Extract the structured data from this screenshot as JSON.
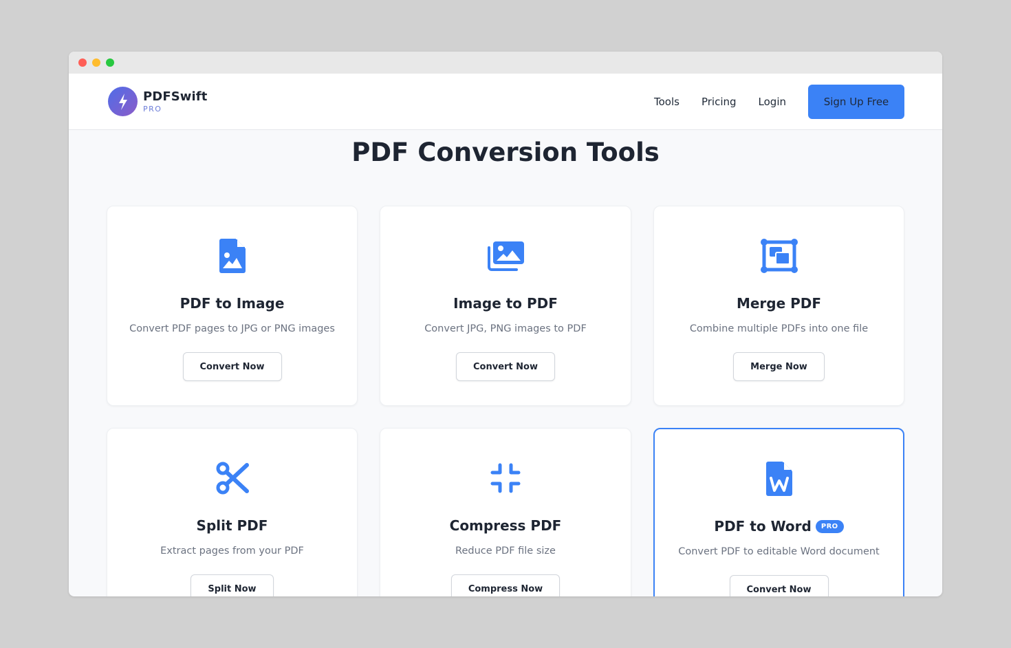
{
  "brand": {
    "name": "PDFSwift",
    "subtitle": "PRO"
  },
  "nav": {
    "links": [
      "Tools",
      "Pricing",
      "Login"
    ],
    "cta": "Sign Up Free"
  },
  "page": {
    "title": "PDF Conversion Tools"
  },
  "colors": {
    "accent": "#3b82f6",
    "text": "#1e2532",
    "muted": "#6b7280"
  },
  "tools": [
    {
      "icon": "file-image-icon",
      "title": "PDF to Image",
      "description": "Convert PDF pages to JPG or PNG images",
      "button": "Convert Now"
    },
    {
      "icon": "images-icon",
      "title": "Image to PDF",
      "description": "Convert JPG, PNG images to PDF",
      "button": "Convert Now"
    },
    {
      "icon": "object-group-icon",
      "title": "Merge PDF",
      "description": "Combine multiple PDFs into one file",
      "button": "Merge Now"
    },
    {
      "icon": "scissors-icon",
      "title": "Split PDF",
      "description": "Extract pages from your PDF",
      "button": "Split Now"
    },
    {
      "icon": "compress-icon",
      "title": "Compress PDF",
      "description": "Reduce PDF file size",
      "button": "Compress Now"
    },
    {
      "icon": "file-word-icon",
      "title": "PDF to Word",
      "badge": "PRO",
      "description": "Convert PDF to editable Word document",
      "button": "Convert Now"
    }
  ]
}
